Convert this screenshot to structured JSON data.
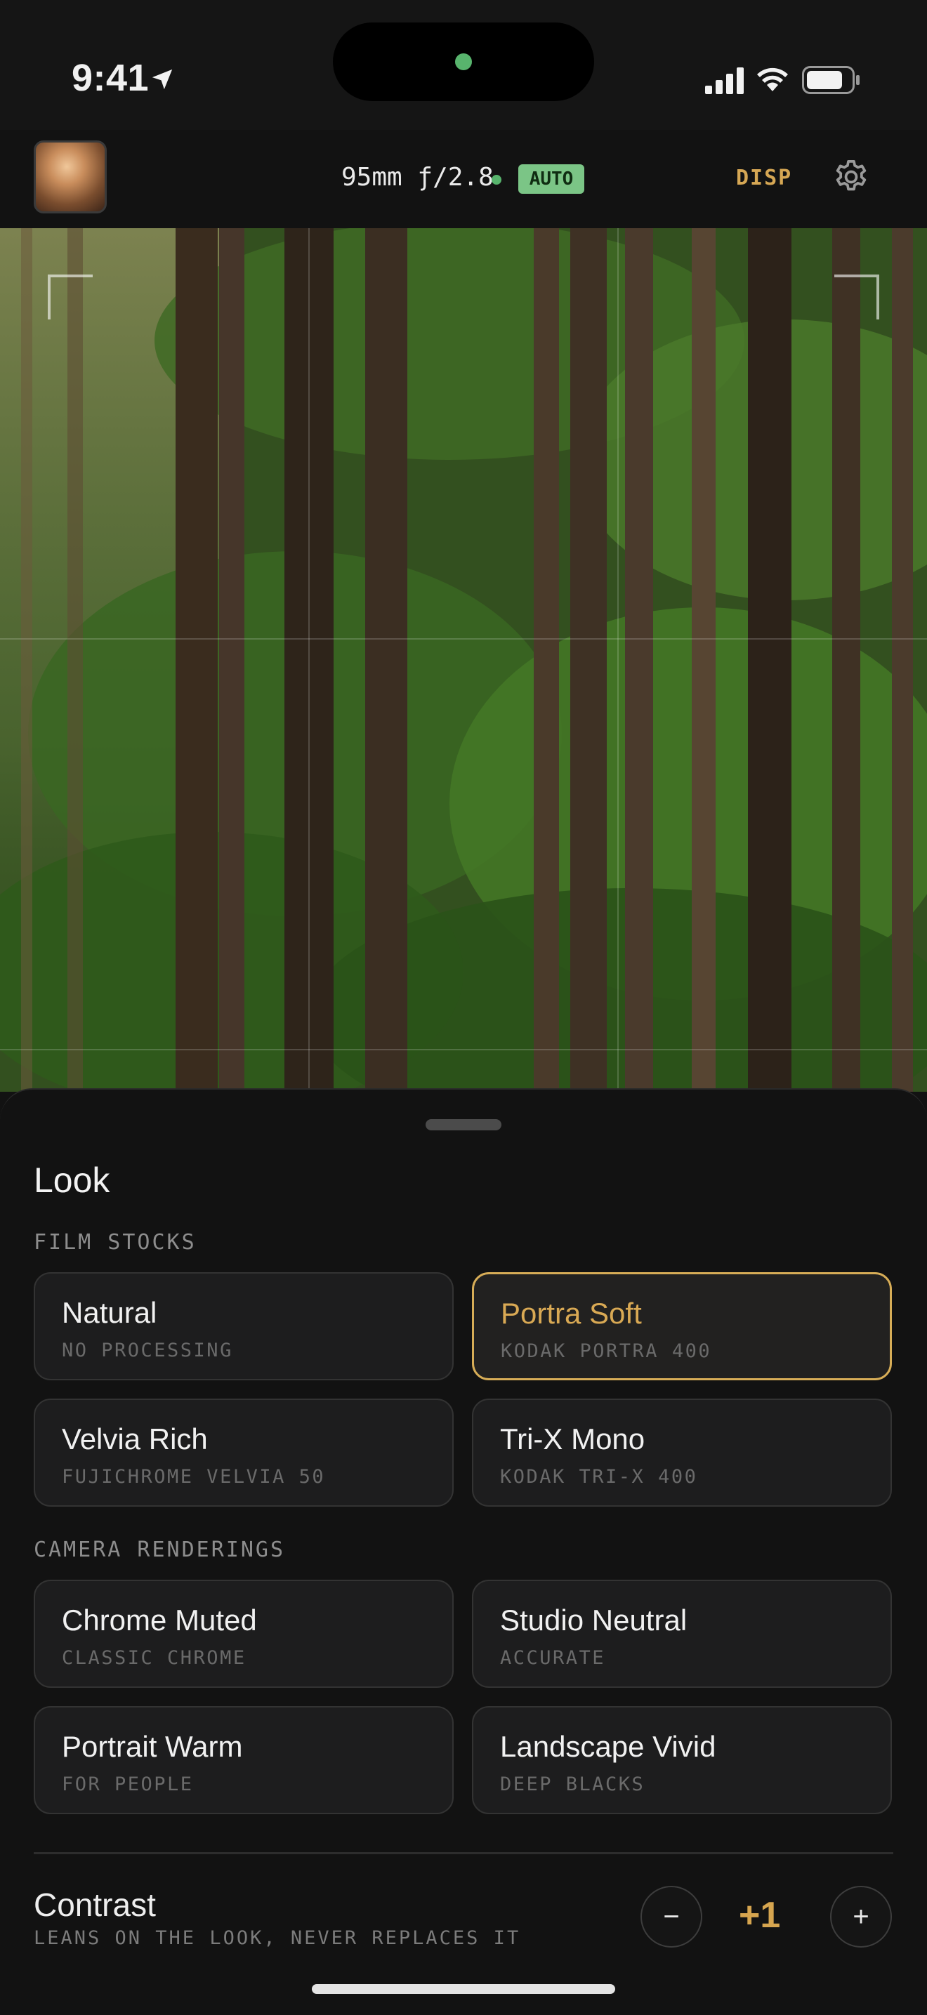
{
  "status_bar": {
    "time": "9:41"
  },
  "toolbar": {
    "lens": "95mm ƒ/2.8",
    "mode_badge": "AUTO",
    "disp_label": "DISP",
    "accent": "#d6a754",
    "auto_color": "#7bc586"
  },
  "sheet": {
    "title": "Look",
    "film_stocks_header": "FILM STOCKS",
    "film_stocks": [
      {
        "name": "Natural",
        "sub": "NO PROCESSING",
        "selected": false
      },
      {
        "name": "Portra Soft",
        "sub": "KODAK PORTRA 400",
        "selected": true
      },
      {
        "name": "Velvia Rich",
        "sub": "FUJICHROME VELVIA 50",
        "selected": false
      },
      {
        "name": "Tri-X Mono",
        "sub": "KODAK TRI-X 400",
        "selected": false
      }
    ],
    "renderings_header": "CAMERA RENDERINGS",
    "renderings": [
      {
        "name": "Chrome Muted",
        "sub": "CLASSIC CHROME"
      },
      {
        "name": "Studio Neutral",
        "sub": "ACCURATE"
      },
      {
        "name": "Portrait Warm",
        "sub": "FOR PEOPLE"
      },
      {
        "name": "Landscape Vivid",
        "sub": "DEEP BLACKS"
      }
    ],
    "contrast": {
      "label": "Contrast",
      "sub": "LEANS ON THE LOOK, NEVER REPLACES IT",
      "value": "+1",
      "minus": "−",
      "plus": "+"
    }
  },
  "icons": {
    "location": "location-arrow-icon",
    "signal": "cellular-signal-icon",
    "wifi": "wifi-icon",
    "battery": "battery-icon",
    "settings": "gear-icon"
  }
}
